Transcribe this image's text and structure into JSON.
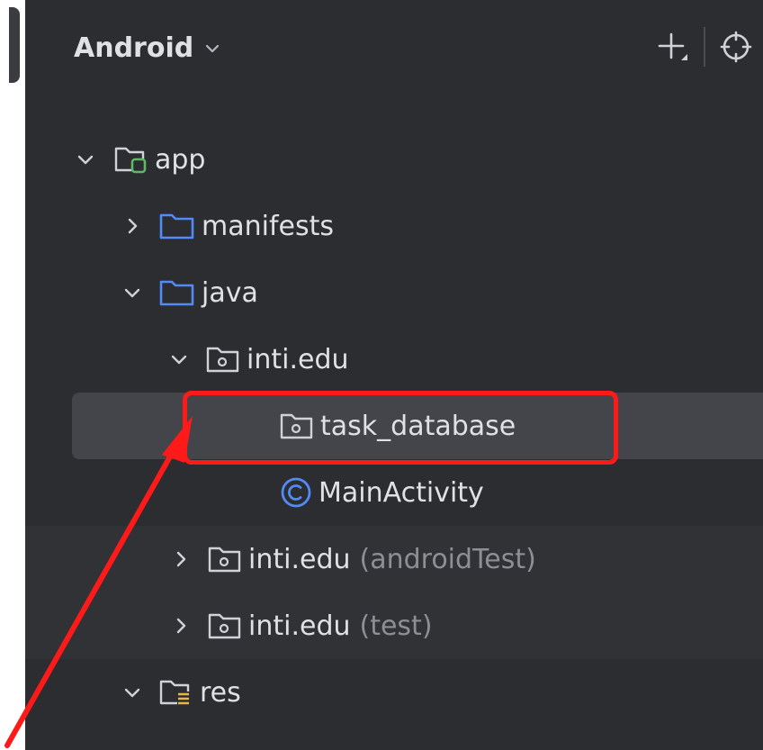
{
  "header": {
    "title": "Android"
  },
  "tree": {
    "app": {
      "label": "app"
    },
    "manifests": {
      "label": "manifests"
    },
    "java": {
      "label": "java"
    },
    "inti_main": {
      "label": "inti.edu"
    },
    "task_database": {
      "label": "task_database"
    },
    "main_activity": {
      "label": "MainActivity"
    },
    "inti_android_test": {
      "label": "inti.edu",
      "suffix": "(androidTest)"
    },
    "inti_test": {
      "label": "inti.edu",
      "suffix": "(test)"
    },
    "res": {
      "label": "res"
    }
  },
  "colors": {
    "panel_bg": "#2b2d30",
    "selected_row": "#43454a",
    "text": "#dfe1e5",
    "muted_text": "#8c8f94",
    "folder_blue": "#548af7",
    "module_green": "#5fb865",
    "annotation_red": "#ff1a1a"
  },
  "icons": {
    "add": "plus-icon",
    "locate": "crosshair-icon",
    "view_mode": "chevron-down-icon"
  }
}
